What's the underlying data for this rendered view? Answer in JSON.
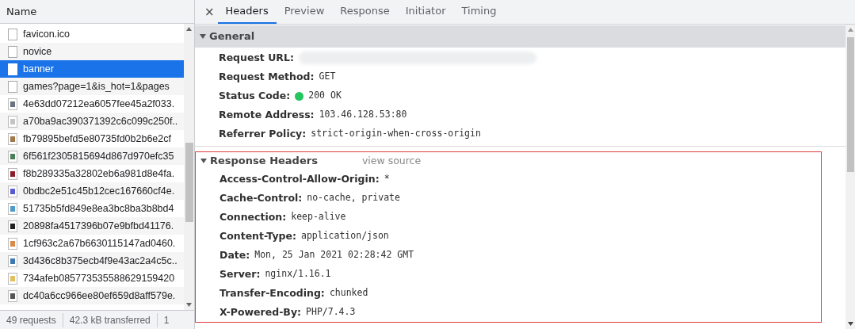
{
  "requests_panel": {
    "column_header": "Name",
    "rows": [
      {
        "name": "favicon.ico",
        "kind": "document",
        "selected": false
      },
      {
        "name": "novice",
        "kind": "document",
        "selected": false
      },
      {
        "name": "banner",
        "kind": "document",
        "selected": true
      },
      {
        "name": "games?page=1&is_hot=1&pages",
        "kind": "document",
        "selected": false
      },
      {
        "name": "4e63dd07212ea6057fee45a2f033.",
        "kind": "image",
        "color": "#6b7280",
        "selected": false
      },
      {
        "name": "a70ba9ac390371392c6c099c250f..",
        "kind": "image",
        "color": "#c4c4c4",
        "selected": false
      },
      {
        "name": "fb79895befd5e80735fd0b2b6e2cf",
        "kind": "image",
        "color": "#a0784a",
        "selected": false
      },
      {
        "name": "6f561f2305815694d867d970efc35",
        "kind": "image",
        "color": "#4b7f5a",
        "selected": false
      },
      {
        "name": "f8b289335a32802eb6a981d8e4fa.",
        "kind": "image",
        "color": "#8b1e2a",
        "selected": false
      },
      {
        "name": "0bdbc2e51c45b12cec167660cf4e.",
        "kind": "image",
        "color": "#5a5ad0",
        "selected": false
      },
      {
        "name": "51735b5fd849e8ea3bc8ba3b8bd4",
        "kind": "image",
        "color": "#4f9cc8",
        "selected": false
      },
      {
        "name": "20898fa4517396b07e9bfbd41176.",
        "kind": "image",
        "color": "#222222",
        "selected": false
      },
      {
        "name": "1cf963c2a67b6630115147ad0460.",
        "kind": "image",
        "color": "#d98a4a",
        "selected": false
      },
      {
        "name": "3d436c8b375ecb4f9e43ac2a4c5c..",
        "kind": "image",
        "color": "#3f78b0",
        "selected": false
      },
      {
        "name": "734afeb085773535588629159420",
        "kind": "image",
        "color": "#e0c060",
        "selected": false
      },
      {
        "name": "dc40a6cc966ee80ef659d8aff579e.",
        "kind": "image",
        "color": "#555555",
        "selected": false
      }
    ],
    "status_bar": [
      "49 requests",
      "42.3 kB transferred",
      "1"
    ]
  },
  "details": {
    "close": "×",
    "tabs": [
      {
        "label": "Headers",
        "selected": true
      },
      {
        "label": "Preview",
        "selected": false
      },
      {
        "label": "Response",
        "selected": false
      },
      {
        "label": "Initiator",
        "selected": false
      },
      {
        "label": "Timing",
        "selected": false
      }
    ],
    "general": {
      "title": "General",
      "expanded": true,
      "fields": [
        {
          "key": "Request URL:",
          "redacted": true
        },
        {
          "key": "Request Method:",
          "value": "GET"
        },
        {
          "key": "Status Code:",
          "value": "200 OK",
          "color": "#22c55e"
        },
        {
          "key": "Remote Address:",
          "value": "103.46.128.53:80"
        },
        {
          "key": "Referrer Policy:",
          "value": "strict-origin-when-cross-origin"
        }
      ]
    },
    "response_headers": {
      "title": "Response Headers",
      "expanded": true,
      "link": "view source",
      "highlighted": true,
      "fields": [
        {
          "key": "Access-Control-Allow-Origin:",
          "value": "*"
        },
        {
          "key": "Cache-Control:",
          "value": "no-cache, private"
        },
        {
          "key": "Connection:",
          "value": "keep-alive"
        },
        {
          "key": "Content-Type:",
          "value": "application/json"
        },
        {
          "key": "Date:",
          "value": "Mon, 25 Jan 2021 02:28:42 GMT"
        },
        {
          "key": "Server:",
          "value": "nginx/1.16.1"
        },
        {
          "key": "Transfer-Encoding:",
          "value": "chunked"
        },
        {
          "key": "X-Powered-By:",
          "value": "PHP/7.4.3"
        }
      ]
    }
  }
}
